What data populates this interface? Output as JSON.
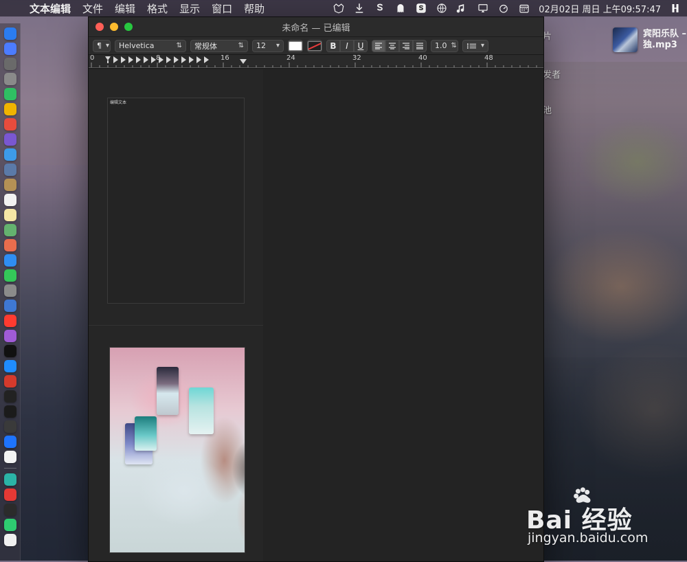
{
  "menubar": {
    "apple_icon": "apple-icon",
    "items": [
      "文本编辑",
      "文件",
      "编辑",
      "格式",
      "显示",
      "窗口",
      "帮助"
    ],
    "status_icons": [
      "fox-icon",
      "download-icon",
      "s-icon",
      "ghost-icon",
      "sogou-icon",
      "globe-icon",
      "music-note-icon",
      "airplay-icon",
      "timer-icon",
      "calendar-icon",
      "unknown-icon"
    ],
    "clock": "02月02日 周日 上午09:57:47"
  },
  "window": {
    "title": "未命名 — 已编辑",
    "toolbar": {
      "paragraph_icon": "paragraph-icon",
      "font_family": "Helvetica",
      "font_style": "常规体",
      "font_size": "12",
      "bold_label": "B",
      "italic_label": "I",
      "underline_label": "U",
      "line_spacing": "1.0"
    },
    "ruler": {
      "labels": [
        "0",
        "8",
        "16",
        "24",
        "32",
        "40",
        "48"
      ]
    },
    "sidebar": {
      "page1_label": "编辑文本"
    }
  },
  "now_playing": {
    "line1": "宾阳乐队 –",
    "line2": "独.mp3"
  },
  "desktop_fragments": [
    "片",
    "发者",
    "池"
  ],
  "watermark": {
    "main": "Bai 经验",
    "url": "jingyan.baidu.com"
  },
  "colors": {
    "traffic_red": "#ff5f57",
    "traffic_yellow": "#febc2e",
    "traffic_green": "#28c840"
  }
}
